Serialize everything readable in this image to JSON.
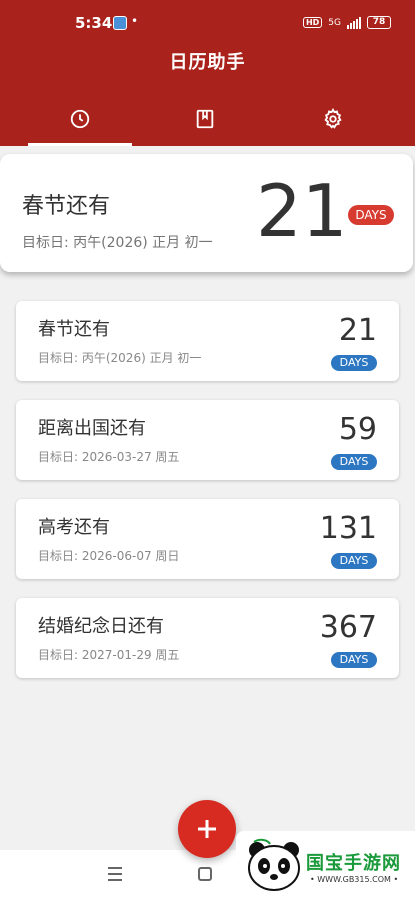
{
  "status_bar": {
    "time": "5:34",
    "dot": "•",
    "hd": "HD",
    "network": "5G",
    "battery": "78"
  },
  "app": {
    "title": "日历助手"
  },
  "tabs": [
    {
      "icon": "clock-icon",
      "active": true
    },
    {
      "icon": "bookmark-icon",
      "active": false
    },
    {
      "icon": "gear-icon",
      "active": false
    }
  ],
  "hero": {
    "title": "春节还有",
    "subtitle": "目标日: 丙午(2026) 正月 初一",
    "days": "21",
    "badge": "DAYS"
  },
  "events": [
    {
      "title": "春节还有",
      "subtitle": "目标日: 丙午(2026) 正月 初一",
      "days": "21",
      "badge": "DAYS"
    },
    {
      "title": "距离出国还有",
      "subtitle": "目标日: 2026-03-27 周五",
      "days": "59",
      "badge": "DAYS"
    },
    {
      "title": "高考还有",
      "subtitle": "目标日: 2026-06-07 周日",
      "days": "131",
      "badge": "DAYS"
    },
    {
      "title": "结婚纪念日还有",
      "subtitle": "目标日: 2027-01-29 周五",
      "days": "367",
      "badge": "DAYS"
    }
  ],
  "fab": {
    "icon": "plus-icon"
  },
  "watermark": {
    "name": "国宝手游网",
    "url": "• WWW.GB315.COM •"
  },
  "colors": {
    "header": "#a9231c",
    "hero_badge": "#d73a2f",
    "card_badge": "#2d77c2",
    "fab": "#d72b22"
  }
}
